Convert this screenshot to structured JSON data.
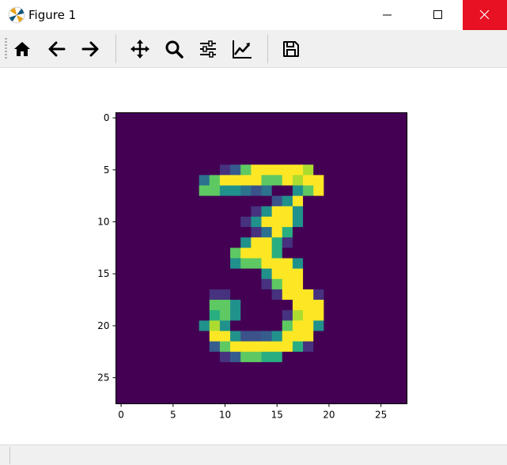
{
  "window": {
    "title": "Figure 1"
  },
  "toolbar": {
    "buttons": [
      {
        "name": "home-button",
        "icon": "home-icon"
      },
      {
        "name": "back-button",
        "icon": "arrow-left-icon"
      },
      {
        "name": "forward-button",
        "icon": "arrow-right-icon"
      },
      {
        "name": "pan-button",
        "icon": "move-icon"
      },
      {
        "name": "zoom-button",
        "icon": "magnifier-icon"
      },
      {
        "name": "configure-subplots-button",
        "icon": "sliders-icon"
      },
      {
        "name": "edit-axis-button",
        "icon": "line-chart-icon"
      },
      {
        "name": "save-button",
        "icon": "floppy-disk-icon"
      }
    ]
  },
  "chart_data": {
    "type": "heatmap",
    "title": "",
    "xlabel": "",
    "ylabel": "",
    "colormap": "viridis",
    "xlim": [
      -0.5,
      27.5
    ],
    "ylim": [
      27.5,
      -0.5
    ],
    "xticks": [
      "0",
      "5",
      "10",
      "15",
      "20",
      "25"
    ],
    "yticks": [
      "0",
      "5",
      "10",
      "15",
      "20",
      "25"
    ],
    "rows": [
      "............................",
      "............................",
      "............................",
      "............................",
      "............................",
      "..........137999998.........",
      "........479999779899........",
      "........7755424..579........",
      "...............259..........",
      ".............15995..........",
      "............159995..........",
      ".............1496...........",
      "............59961...........",
      "...........79996............",
      "...........5779995..........",
      "..............5999..........",
      "..............1799..........",
      ".........11....19991........",
      ".........775.....999........",
      ".........675....1899........",
      "........585.....7995........",
      ".........9952235999.........",
      ".........3799999961.........",
      "..........137766............",
      "............................",
      "............................",
      "............................",
      "............................"
    ]
  }
}
